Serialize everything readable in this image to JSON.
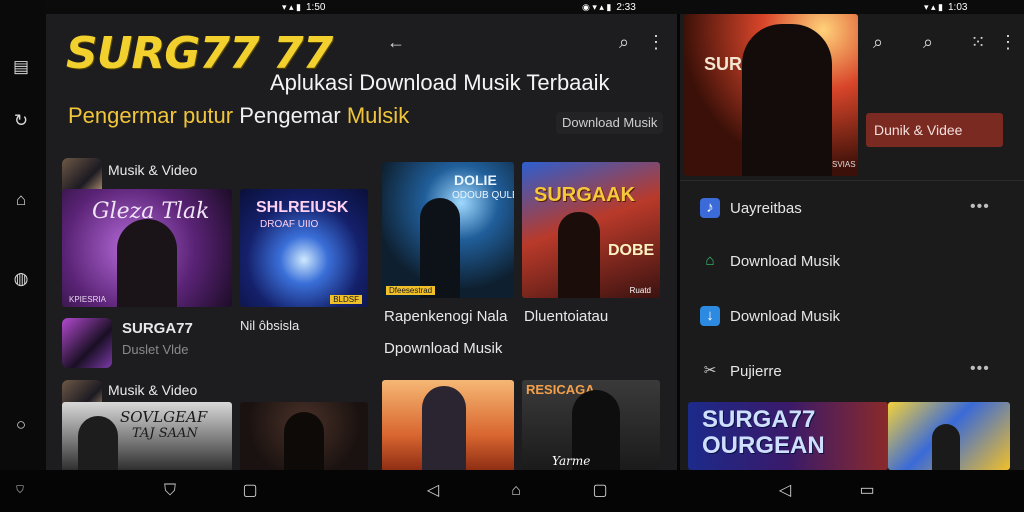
{
  "status_bars": [
    {
      "time": "1:50",
      "icons": "▾ ▴ ▮"
    },
    {
      "time": "2:33",
      "icons": "◉ ▾ ▴ ▮"
    },
    {
      "time": "1:03",
      "icons": "▾ ▴ ▮"
    }
  ],
  "left_rail": {
    "icons": [
      "book-icon",
      "refresh-icon",
      "home-icon",
      "bag-icon",
      "circle-icon",
      "settings-icon"
    ]
  },
  "hero": {
    "logo_text": "SURG77  77",
    "headline": "Aplukasi Download Musik Terbaaik",
    "tagline_part1": "Pengermar putur",
    "tagline_part2": "Pengemar",
    "tagline_part3": "Mulsik",
    "pill_label": "Download Musik"
  },
  "section_a": {
    "title": "Musik & Video",
    "card1_art_text": "Gleza Tlak",
    "card2_art_text": "SHLREIUSK",
    "card2_art_sub": "DROAF UIIO",
    "card1_caption": "SURGA77",
    "card1_subcaption": "Duslet Vlde",
    "card2_caption": "Nil ôbsisla",
    "card1_foot": "KPIESRIA",
    "card2_foot": "BLDSF"
  },
  "section_b": {
    "card3_art_text": "DOLIE",
    "card3_art_sub": "ODOUB QULE",
    "card3_foot": "Dfeesestrad",
    "card4_art_text": "SURGAAK",
    "card4_art_sub": "DOBE",
    "card4_foot": "Ruatd",
    "caption1": "Rapenkenogi Nala",
    "caption2": "Dluentoiatau",
    "caption3": "Dpownload Musik"
  },
  "section_c": {
    "title": "Musik & Video",
    "card5_art_text": "SOVLGEAF",
    "card5_art_sub": "TAJ SAAN",
    "card8_art_text": "RESICAGA",
    "card8_art_sub": "Yarme"
  },
  "right_panel": {
    "poster_brand": "SURG77",
    "poster_foot": "SVIAS",
    "button_label": "Dunik & Videe",
    "menu": [
      {
        "icon": "music-note-icon",
        "label": "Uayreitbas",
        "icon_color": "#3a6bd8"
      },
      {
        "icon": "home-outline-icon",
        "label": "Download Musik",
        "icon_color": "#3ac470"
      },
      {
        "icon": "download-icon",
        "label": "Download Musik",
        "icon_color": "#2c8be0"
      },
      {
        "icon": "tools-icon",
        "label": "Pujierre",
        "icon_color": "#cfcfcf"
      }
    ],
    "more_label": "•••",
    "banner_text": "SURGA77",
    "banner_sub": "OURGEAN"
  }
}
